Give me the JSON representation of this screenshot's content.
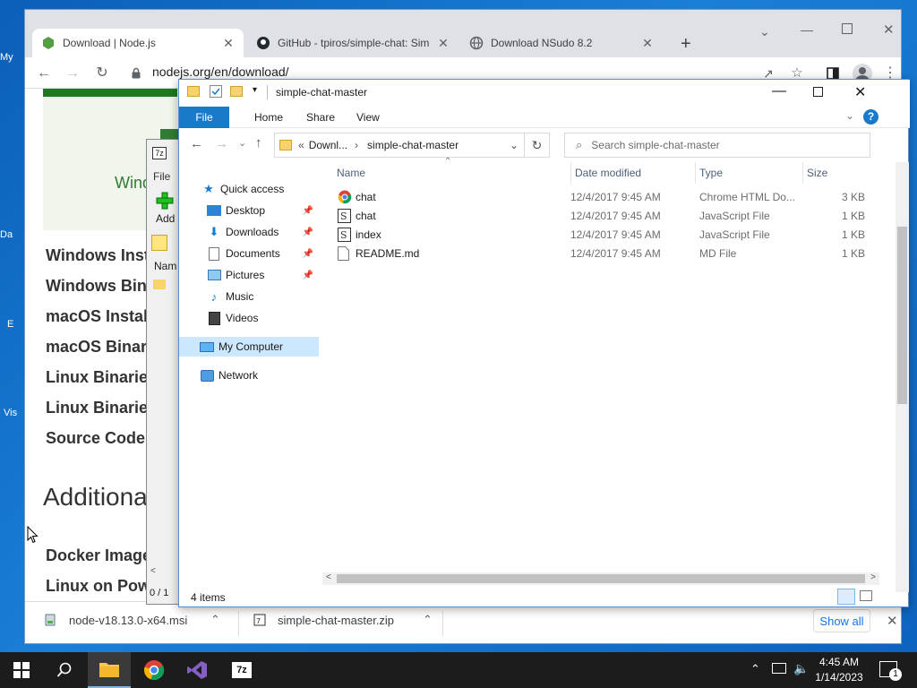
{
  "browser": {
    "tabs": [
      {
        "title": "Download | Node.js",
        "icon": "nodejs-icon",
        "active": true
      },
      {
        "title": "GitHub - tpiros/simple-chat: Sim",
        "icon": "github-icon",
        "active": false
      },
      {
        "title": "Download NSudo 8.2",
        "icon": "globe-icon",
        "active": false
      }
    ],
    "url": "nodejs.org/en/download/",
    "page": {
      "windows_partial": "Wind",
      "links": [
        "Windows Inst",
        "Windows Bina",
        "macOS Instal",
        "macOS Binar",
        "Linux Binarie",
        "Linux Binarie",
        "Source Code"
      ],
      "section_title": "Additiona",
      "more_links": [
        "Docker Image",
        "Linux on Pow"
      ]
    },
    "downloads": {
      "items": [
        "node-v18.13.0-x64.msi",
        "simple-chat-master.zip"
      ],
      "show_all": "Show all"
    }
  },
  "sevenzip": {
    "menu_file": "File",
    "add_label": "Add",
    "col_name": "Nam",
    "status": "0 / 1"
  },
  "explorer": {
    "title": "simple-chat-master",
    "ribbon_tabs": [
      "File",
      "Home",
      "Share",
      "View"
    ],
    "breadcrumb": [
      "Downl...",
      "simple-chat-master"
    ],
    "search_placeholder": "Search simple-chat-master",
    "nav": {
      "quick_access": "Quick access",
      "pinned": [
        "Desktop",
        "Downloads",
        "Documents",
        "Pictures"
      ],
      "other": [
        "Music",
        "Videos"
      ],
      "my_computer": "My Computer",
      "network": "Network"
    },
    "columns": [
      "Name",
      "Date modified",
      "Type",
      "Size"
    ],
    "files": [
      {
        "name": "chat",
        "date": "12/4/2017 9:45 AM",
        "type": "Chrome HTML Do...",
        "size": "3 KB",
        "icon": "chrome-html-icon"
      },
      {
        "name": "chat",
        "date": "12/4/2017 9:45 AM",
        "type": "JavaScript File",
        "size": "1 KB",
        "icon": "js-file-icon"
      },
      {
        "name": "index",
        "date": "12/4/2017 9:45 AM",
        "type": "JavaScript File",
        "size": "1 KB",
        "icon": "js-file-icon"
      },
      {
        "name": "README.md",
        "date": "12/4/2017 9:45 AM",
        "type": "MD File",
        "size": "1 KB",
        "icon": "text-file-icon"
      }
    ],
    "status": "4 items"
  },
  "desktop": {
    "icon_labels": [
      "My",
      "Da",
      "E",
      "Vis"
    ]
  },
  "taskbar": {
    "time": "4:45 AM",
    "date": "1/14/2023",
    "notification_count": "1"
  },
  "colors": {
    "taskbar": "#1c1c1c",
    "explorer_file_tab": "#1979ca",
    "selection": "#cce8ff"
  }
}
